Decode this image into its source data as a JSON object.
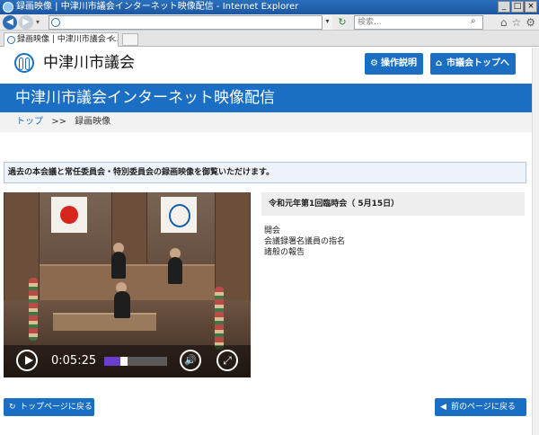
{
  "browser": {
    "window_title": "録画映像 | 中津川市議会インターネット映像配信 - Internet Explorer",
    "window_buttons": [
      "_",
      "□",
      "×"
    ],
    "search_placeholder": "検索...",
    "tab_title": "録画映像 | 中津川市議会イ...",
    "tab_close": "×",
    "back_icon": "◀",
    "forward_icon": "▶",
    "toolbar_icons": [
      "⌂",
      "☆",
      "⚙"
    ]
  },
  "header": {
    "site_name": "中津川市議会",
    "howto_label": "操作説明",
    "howto_icon": "⚙",
    "council_top_label": "市議会トップへ",
    "council_top_icon": "⌂"
  },
  "banner": {
    "title": "中津川市議会インターネット映像配信"
  },
  "breadcrumb": {
    "home": "トップ",
    "separator": ">>",
    "current": "録画映像"
  },
  "notice": {
    "text": "過去の本会議と常任委員会・特別委員会の録画映像を御覧いただけます。"
  },
  "player": {
    "time": "0:05:25",
    "progress_fraction": 0.25,
    "progress_color": "#6a3fd0"
  },
  "session": {
    "title": "令和元年第1回臨時会（ 5月15日）",
    "agenda": [
      "開会",
      "会議録署名議員の指名",
      "諸般の報告"
    ]
  },
  "footer": {
    "home_label": "トップページに戻る",
    "home_icon": "↻",
    "prev_label": "前のページに戻る",
    "prev_icon": "◀"
  },
  "colors": {
    "brand_blue": "#1a6fc4"
  }
}
